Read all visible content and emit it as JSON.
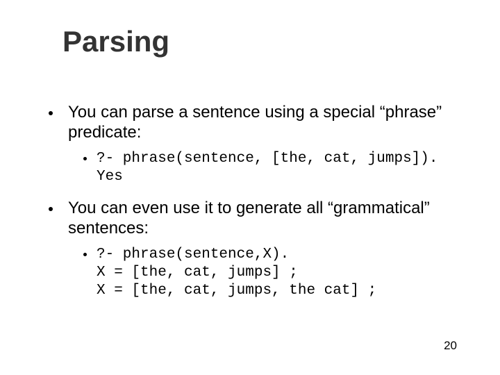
{
  "title": "Parsing",
  "bullets": {
    "b1": {
      "text": "You can parse a sentence using a special “phrase” predicate:",
      "sub": "?- phrase(sentence, [the, cat, jumps]).\nYes"
    },
    "b2": {
      "text": "You can even use it to generate all “grammatical” sentences:",
      "sub": "?- phrase(sentence,X).\nX = [the, cat, jumps] ;\nX = [the, cat, jumps, the cat] ;"
    }
  },
  "pagenum": "20"
}
